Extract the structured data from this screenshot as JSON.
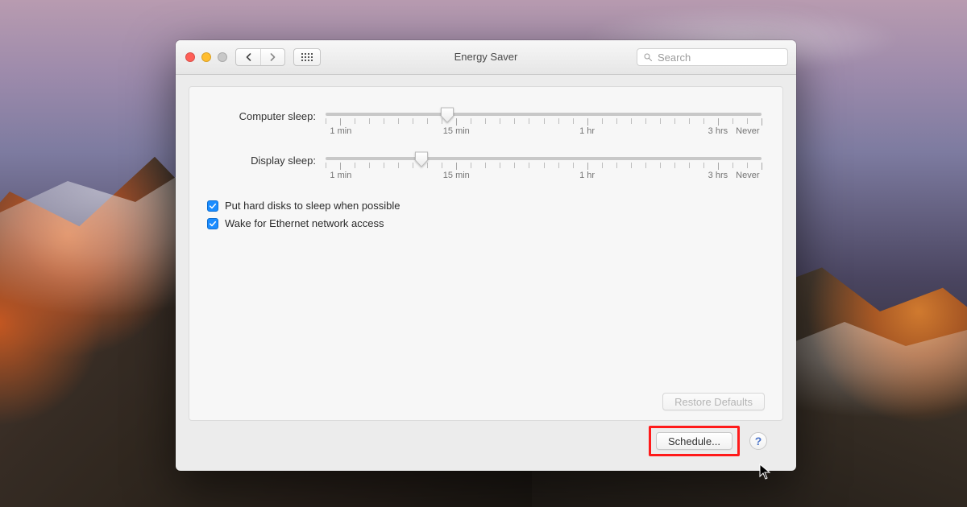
{
  "window": {
    "title": "Energy Saver",
    "search_placeholder": "Search"
  },
  "sliders": {
    "computer": {
      "label": "Computer sleep:",
      "thumb_pct": 28
    },
    "display": {
      "label": "Display sleep:",
      "thumb_pct": 22
    },
    "marks": {
      "min": {
        "label": "1 min",
        "pct": 2
      },
      "m15": {
        "label": "15 min",
        "pct": 30
      },
      "h1": {
        "label": "1 hr",
        "pct": 60
      },
      "h3": {
        "label": "3 hrs",
        "pct": 90
      },
      "never": {
        "label": "Never",
        "pct": 99
      }
    }
  },
  "checkboxes": {
    "hdd_sleep": {
      "label": "Put hard disks to sleep when possible",
      "checked": true
    },
    "wake_net": {
      "label": "Wake for Ethernet network access",
      "checked": true
    }
  },
  "buttons": {
    "restore_defaults": "Restore Defaults",
    "schedule": "Schedule...",
    "help": "?"
  }
}
